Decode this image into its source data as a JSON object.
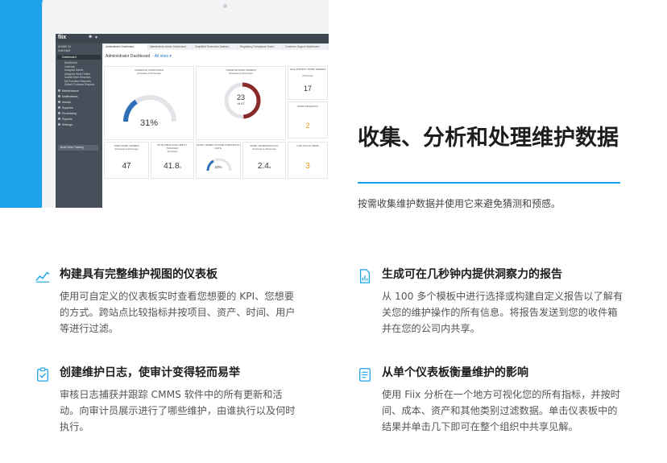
{
  "app": {
    "logo": "fiix",
    "user_name": "ADMIN CIL",
    "user_role": "Zoie Kaidi",
    "sidebar_section": "Dashboard",
    "sidebar_subitems": [
      "Dashboard",
      "Calendar",
      "Assigned Assets",
      "Assigned Work Orders",
      "Submit Work Requests",
      "My Purchase Requests",
      "Submit Purchase Request"
    ],
    "sidebar_items": [
      "Maintenance",
      "Notifications",
      "Assets",
      "Supplies",
      "Purchasing",
      "Reports",
      "Settings"
    ],
    "sidebar_button": "Book Video Training",
    "tabs": [
      "Administrator Dashboard",
      "Maintenance Admin Dashboard",
      "Simplified Technician Dashbo...",
      "Regulatory Compliance Dash...",
      "Customer Support Dashboard"
    ],
    "dashboard_title": "Administrator Dashboard",
    "dashboard_filter": "All sites",
    "panels": {
      "schedule_compliance": {
        "title": "SCHEDULE COMPLIANCE",
        "sub": "All Assets & All Groups",
        "value": "31%",
        "fraction": 0.31
      },
      "overdue_work_orders": {
        "title": "OVERDUE WORK ORDERS",
        "sub": "All Assets & All Groups",
        "value": "23",
        "of": "of 47",
        "fraction": 0.49
      },
      "high_priority": {
        "title": "HIGH PRIORITY WORK ORDERS",
        "sub": "All Groups",
        "value": "17"
      },
      "work_requests": {
        "title": "WORK REQUESTS",
        "value": "2"
      },
      "low_stock": {
        "title": "LOW STOCK ITEMS",
        "value": "3"
      },
      "open_work_orders": {
        "title": "OPEN WORK ORDERS",
        "sub": "All Assets & All Groups",
        "value": "47"
      },
      "mttr": {
        "title": "MTTR (MEAN AVAILABILITY TRACKER)",
        "sub": "All Assets",
        "value": "41.8",
        "unit": "h"
      },
      "on_time": {
        "title": "WORK ORDER ON-TIME COMPLETION RATE",
        "value": "33%",
        "fraction": 0.33
      },
      "backlog": {
        "title": "WORK ORDER BACKLOG",
        "sub": "All Assets & All Groups",
        "value": "2.4",
        "unit": "d"
      }
    }
  },
  "hero": {
    "title": "收集、分析和处理维护数据",
    "subtitle": "按需收集维护数据并使用它来避免猜测和预感。"
  },
  "features": [
    {
      "icon": "line-chart-icon",
      "title": "构建具有完整维护视图的仪表板",
      "body": "使用可自定义的仪表板实时查看您想要的 KPI、您想要的方式。跨站点比较指标并按项目、资产、时间、用户等进行过滤。"
    },
    {
      "icon": "document-chart-icon",
      "title": "生成可在几秒钟内提供洞察力的报告",
      "body": "从 100 多个模板中进行选择或构建自定义报告以了解有关您的维护操作的所有信息。将报告发送到您的收件箱并在您的公司内共享。"
    },
    {
      "icon": "clipboard-check-icon",
      "title": "创建维护日志，使审计变得轻而易举",
      "body": "审核日志捕获并跟踪 CMMS 软件中的所有更新和活动。向审计员展示进行了哪些维护，由谁执行以及何时执行。"
    },
    {
      "icon": "list-document-icon",
      "title": "从单个仪表板衡量维护的影响",
      "body": "使用 Fiix 分析在一个地方可视化您的所有指标，并按时间、成本、资产和其他类别过滤数据。单击仪表板中的结果并单击几下即可在整个组织中共享见解。"
    }
  ],
  "colors": {
    "brand_blue": "#1aa3ea",
    "gauge_blue": "#2f6fb7",
    "gauge_red": "#8a2a2a",
    "accent_orange": "#f39c12"
  }
}
